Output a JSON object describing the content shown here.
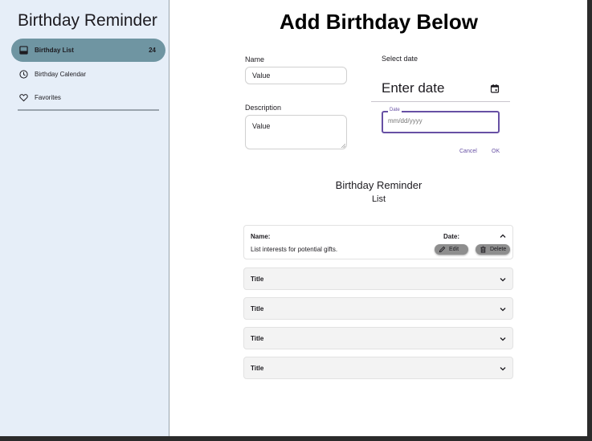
{
  "sidebar": {
    "title": "Birthday Reminder",
    "items": [
      {
        "label": "Birthday List",
        "badge": "24",
        "icon": "inbox-icon"
      },
      {
        "label": "Birthday Calendar",
        "badge": "",
        "icon": "clock-icon"
      },
      {
        "label": "Favorites",
        "badge": "",
        "icon": "heart-icon"
      }
    ]
  },
  "main": {
    "title": "Add Birthday Below",
    "form": {
      "name_label": "Name",
      "name_value": "Value",
      "description_label": "Description",
      "description_value": "Value"
    },
    "datepicker": {
      "select_label": "Select date",
      "headline": "Enter date",
      "field_label": "Date",
      "field_placeholder": "mm/dd/yyyy",
      "cancel_label": "Cancel",
      "ok_label": "OK"
    },
    "list": {
      "heading_line1": "Birthday Reminder",
      "heading_line2": "List",
      "expanded_item": {
        "name_label": "Name:",
        "date_label": "Date:",
        "description": "List interests for potential gifts.",
        "edit_label": "Edit",
        "delete_label": "Delete"
      },
      "collapsed_items": [
        {
          "title": "Title"
        },
        {
          "title": "Title"
        },
        {
          "title": "Title"
        },
        {
          "title": "Title"
        }
      ]
    }
  },
  "colors": {
    "sidebar_bg": "#e6eef8",
    "active_nav": "#6f95a2",
    "accent": "#6750a4",
    "button_gray": "#8e8e8e"
  }
}
